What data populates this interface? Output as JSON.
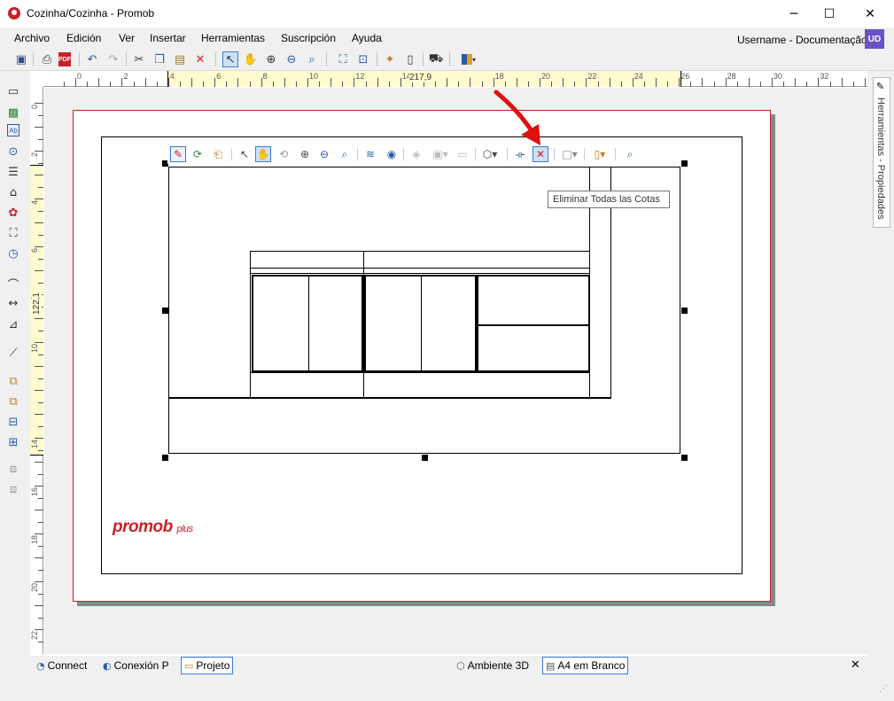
{
  "window": {
    "title": "Cozinha/Cozinha - Promob",
    "minimize": "─",
    "maximize": "☐",
    "close": "✕"
  },
  "menu": [
    "Archivo",
    "Edición",
    "Ver",
    "Insertar",
    "Herramientas",
    "Suscripción",
    "Ayuda"
  ],
  "user": {
    "name": "Username - Documentação",
    "initials": "UD"
  },
  "toolbar": {
    "icons": [
      "save-icon",
      "print-icon",
      "pdf-icon",
      "undo-icon",
      "redo-icon",
      "cut-icon",
      "copy-icon",
      "paste-icon",
      "delete-icon",
      "select-icon",
      "pan-icon",
      "zoom-in-icon",
      "zoom-out-icon",
      "zoom-window-icon",
      "fit-icon",
      "fit-all-icon",
      "render-icon",
      "new-page-icon",
      "paint-icon",
      "color-icon"
    ],
    "pdf_label": "PDF"
  },
  "ruler": {
    "horizontal_labels": [
      "0",
      "2",
      "4",
      "6",
      "8",
      "10",
      "12",
      "14",
      "16",
      "18",
      "20",
      "22",
      "24",
      "26",
      "28",
      "30",
      "32"
    ],
    "horizontal_value": "217,9",
    "vertical_labels": [
      "0",
      "2",
      "4",
      "6",
      "8",
      "10",
      "12",
      "14",
      "16",
      "18",
      "20",
      "22"
    ],
    "vertical_value": "122,1"
  },
  "view_toolbar": {
    "icons": [
      "edit-view-icon",
      "refresh-icon",
      "export-icon",
      "select-icon",
      "pan-icon",
      "orbit-icon",
      "zoom-in-icon",
      "zoom-out-icon",
      "zoom-window-icon",
      "layers-icon",
      "visibility-icon",
      "render-icon",
      "views-icon",
      "frame-icon",
      "cube-icon",
      "dimension-icon",
      "remove-all-dimensions-icon",
      "fill-icon",
      "door-icon",
      "zoom-extents-icon"
    ],
    "tooltip": "Eliminar Todas las Cotas"
  },
  "logo": {
    "text": "promob",
    "suffix": "plus"
  },
  "side_panel": {
    "label": "Herramientas - Propiedades"
  },
  "status_tabs": [
    {
      "label": "Connect",
      "icon": "rss-icon",
      "active": false
    },
    {
      "label": "Conexión P",
      "icon": "promob-icon",
      "active": false
    },
    {
      "label": "Projeto",
      "icon": "folder-icon",
      "active": true
    },
    {
      "label": "Ambiente 3D",
      "icon": "3d-icon",
      "active": false
    },
    {
      "label": "A4 em Branco",
      "icon": "page-icon",
      "active": true
    }
  ],
  "status_close": "✕",
  "colors": {
    "brand": "#c8202a",
    "avatar": "#6a52c4",
    "accent": "#3a7bd5"
  }
}
